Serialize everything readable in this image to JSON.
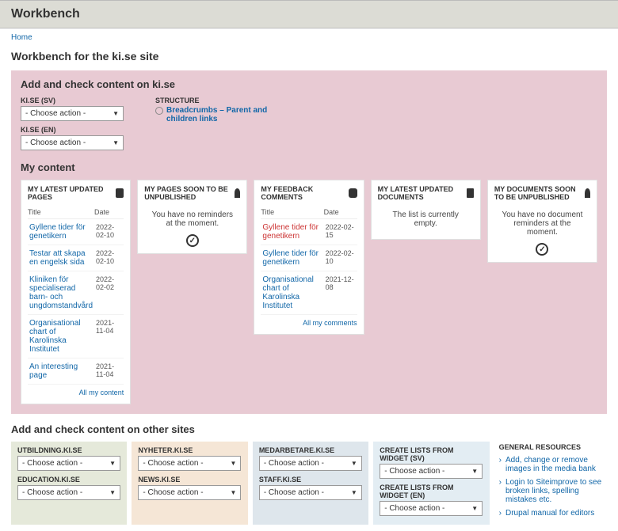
{
  "header": {
    "title": "Workbench"
  },
  "breadcrumb": {
    "home": "Home"
  },
  "page_title": "Workbench for the ki.se site",
  "add_check": {
    "title": "Add and check content on ki.se",
    "sv_label": "KI.SE (SV)",
    "en_label": "KI.SE (EN)",
    "choose": "- Choose action -",
    "structure_label": "STRUCTURE",
    "breadcrumbs_link": "Breadcrumbs – Parent and children links"
  },
  "my_content": {
    "title": "My content",
    "cards": {
      "latest_pages": {
        "title": "MY LATEST UPDATED PAGES",
        "col_title": "Title",
        "col_date": "Date",
        "rows": [
          {
            "title": "Gyllene tider för genetikern",
            "date": "2022-02-10"
          },
          {
            "title": "Testar att skapa en engelsk sida",
            "date": "2022-02-10"
          },
          {
            "title": "Kliniken för specialiserad barn- och ungdomstandvård",
            "date": "2022-02-02"
          },
          {
            "title": "Organisational chart of Karolinska Institutet",
            "date": "2021-11-04"
          },
          {
            "title": "An interesting page",
            "date": "2021-11-04"
          }
        ],
        "footer": "All my content"
      },
      "unpub_pages": {
        "title": "MY PAGES SOON TO BE UNPUBLISHED",
        "empty": "You have no reminders at the moment."
      },
      "feedback": {
        "title": "MY FEEDBACK COMMENTS",
        "col_title": "Title",
        "col_date": "Date",
        "rows": [
          {
            "title": "Gyllene tider för genetikern",
            "date": "2022-02-15",
            "red": true
          },
          {
            "title": "Gyllene tider för genetikern",
            "date": "2022-02-10"
          },
          {
            "title": "Organisational chart of Karolinska Institutet",
            "date": "2021-12-08"
          }
        ],
        "footer": "All my comments"
      },
      "latest_docs": {
        "title": "MY LATEST UPDATED DOCUMENTS",
        "empty": "The list is currently empty."
      },
      "unpub_docs": {
        "title": "MY DOCUMENTS SOON TO BE UNPUBLISHED",
        "empty": "You have no document reminders at the moment."
      }
    }
  },
  "other_sites": {
    "title": "Add and check content on other sites",
    "choose": "- Choose action -",
    "utbildning": "UTBILDNING.KI.SE",
    "education": "EDUCATION.KI.SE",
    "nyheter": "NYHETER.KI.SE",
    "news": "NEWS.KI.SE",
    "medarbetare": "MEDARBETARE.KI.SE",
    "staff": "STAFF.KI.SE",
    "widget_sv": "CREATE LISTS FROM WIDGET (SV)",
    "widget_en": "CREATE LISTS FROM WIDGET (EN)"
  },
  "resources": {
    "title": "GENERAL RESOURCES",
    "links": [
      "Add, change or remove images in the media bank",
      "Login to Siteimprove to see broken links, spelling mistakes etc.",
      "Drupal manual for editors"
    ]
  }
}
